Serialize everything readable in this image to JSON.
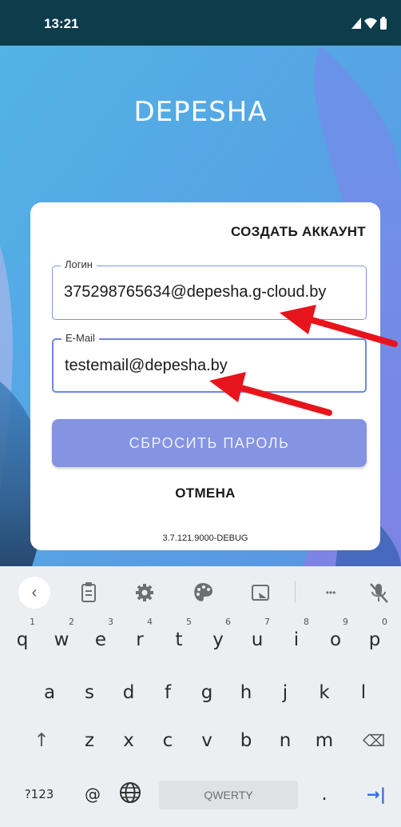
{
  "status_bar": {
    "time": "13:21"
  },
  "app": {
    "logo": "DEPESHA"
  },
  "card": {
    "create_account_label": "СОЗДАТЬ АККАУНТ",
    "login_field": {
      "label": "Логин",
      "value": "375298765634@depesha.g-cloud.by"
    },
    "email_field": {
      "label": "E-Mail",
      "value": "testemail@depesha.by"
    },
    "reset_button_label": "СБРОСИТЬ ПАРОЛЬ",
    "cancel_label": "ОТМЕНА",
    "version": "3.7.121.9000-DEBUG"
  },
  "keyboard": {
    "toolbar_icons": [
      "back-icon",
      "clipboard-icon",
      "settings-icon",
      "palette-icon",
      "resize-icon",
      "more-icon",
      "mic-off-icon"
    ],
    "more_label": "•••",
    "row1": [
      {
        "key": "q",
        "hint": "1"
      },
      {
        "key": "w",
        "hint": "2"
      },
      {
        "key": "e",
        "hint": "3"
      },
      {
        "key": "r",
        "hint": "4"
      },
      {
        "key": "t",
        "hint": "5"
      },
      {
        "key": "y",
        "hint": "6"
      },
      {
        "key": "u",
        "hint": "7"
      },
      {
        "key": "i",
        "hint": "8"
      },
      {
        "key": "o",
        "hint": "9"
      },
      {
        "key": "p",
        "hint": "0"
      }
    ],
    "row2": [
      "a",
      "s",
      "d",
      "f",
      "g",
      "h",
      "j",
      "k",
      "l"
    ],
    "row3": [
      "z",
      "x",
      "c",
      "v",
      "b",
      "n",
      "m"
    ],
    "shift_label": "↑",
    "backspace_label": "⌫",
    "symbols_label": "?123",
    "at_label": "@",
    "space_label": "QWERTY",
    "period_label": ".",
    "enter_label": "→|"
  },
  "colors": {
    "status_bar": "#0d3c4b",
    "accent_button": "#8593e3",
    "field_border": "#7f95e0",
    "annotation_arrow": "#e8141b",
    "enter_key": "#2d6be0"
  }
}
